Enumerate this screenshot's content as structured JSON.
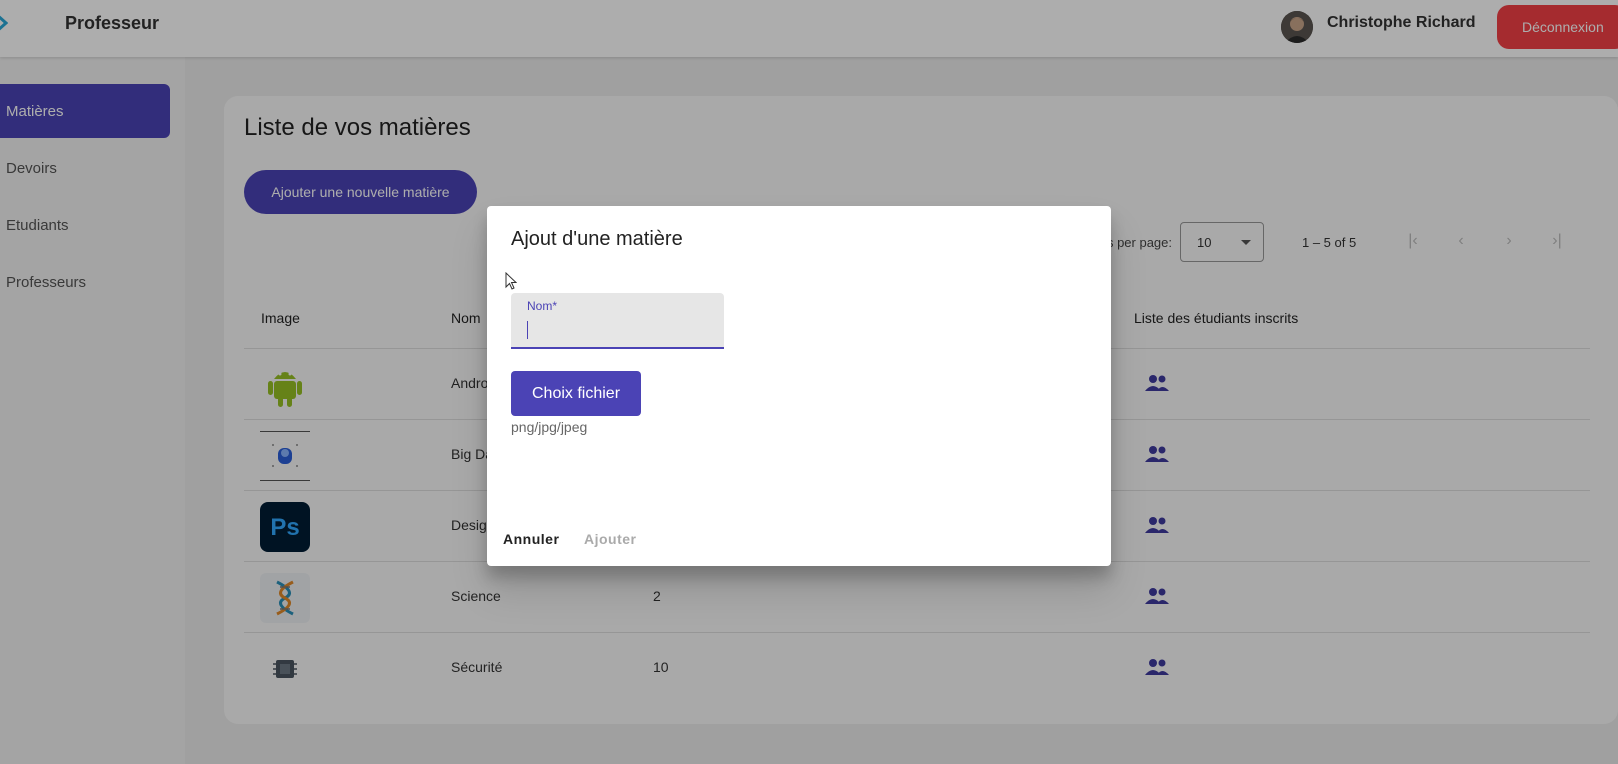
{
  "header": {
    "title": "Professeur",
    "user_name": "Christophe Richard",
    "logout_label": "Déconnexion"
  },
  "sidebar": {
    "items": [
      {
        "label": "Matières",
        "active": true
      },
      {
        "label": "Devoirs",
        "active": false
      },
      {
        "label": "Etudiants",
        "active": false
      },
      {
        "label": "Professeurs",
        "active": false
      }
    ]
  },
  "main": {
    "title": "Liste de vos matières",
    "add_button_label": "Ajouter une nouvelle matière",
    "paginator": {
      "items_per_page_label": "Items per page:",
      "page_size": "10",
      "range_label": "1 – 5 of 5"
    },
    "table": {
      "columns": [
        "Image",
        "Nom",
        "",
        "Liste des étudiants inscrits"
      ],
      "rows": [
        {
          "image_icon": "android-icon",
          "name": "Android",
          "count": ""
        },
        {
          "image_icon": "big-data-icon",
          "name": "Big Data",
          "count": ""
        },
        {
          "image_icon": "photoshop-icon",
          "name": "Design",
          "count": ""
        },
        {
          "image_icon": "dna-icon",
          "name": "Science",
          "count": "2"
        },
        {
          "image_icon": "chip-icon",
          "name": "Sécurité",
          "count": "10"
        }
      ]
    }
  },
  "dialog": {
    "title": "Ajout d'une matière",
    "name_field_label": "Nom*",
    "name_field_value": "",
    "file_button_label": "Choix fichier",
    "file_hint": "png/jpg/jpeg",
    "cancel_label": "Annuler",
    "submit_label": "Ajouter"
  },
  "colors": {
    "primary": "#4b43b5",
    "danger": "#f44046"
  }
}
